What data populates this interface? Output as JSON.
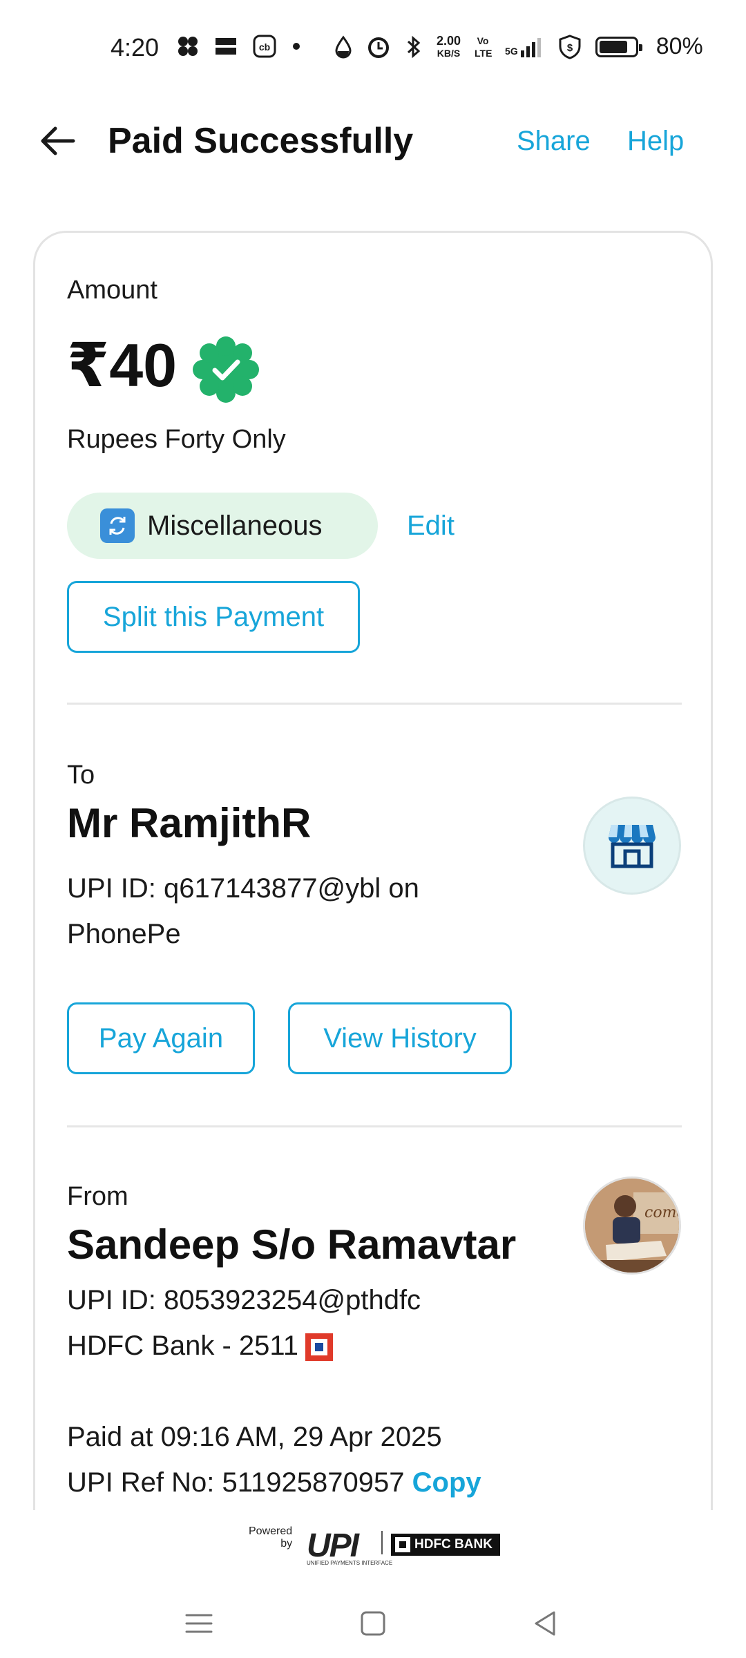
{
  "status_bar": {
    "time": "4:20",
    "net_speed": "2.00",
    "net_unit": "KB/S",
    "volte": "Vo LTE",
    "signal": "5G",
    "battery_pct": "80%",
    "battery_level": 0.8,
    "icons": [
      "pinwheel-icon",
      "news-app-icon",
      "cb-app-icon",
      "dot-icon",
      "drop-icon",
      "alarm-icon",
      "bluetooth-icon",
      "shield-dollar-icon",
      "battery-icon"
    ]
  },
  "header": {
    "title": "Paid Successfully",
    "share_label": "Share",
    "help_label": "Help"
  },
  "amount_section": {
    "label": "Amount",
    "amount": "₹40",
    "words": "Rupees Forty Only",
    "category": "Miscellaneous",
    "edit_label": "Edit",
    "split_label": "Split this Payment"
  },
  "to_section": {
    "label": "To",
    "name": "Mr RamjithR",
    "upi_line1": "UPI ID: q617143877@ybl on",
    "upi_line2": "PhonePe",
    "pay_again_label": "Pay Again",
    "view_history_label": "View History"
  },
  "from_section": {
    "label": "From",
    "name": "Sandeep S/o Ramavtar",
    "upi_id": "UPI ID: 8053923254@pthdfc",
    "bank": "HDFC Bank - 2511",
    "paid_at": "Paid at 09:16 AM, 29 Apr 2025",
    "ref_no": "UPI Ref No: 511925870957",
    "copy_label": "Copy"
  },
  "footer": {
    "powered_line1": "Powered",
    "powered_line2": "by",
    "upi_text": "UPI",
    "upi_sub": "UNIFIED PAYMENTS INTERFACE",
    "bank_text": "HDFC BANK"
  },
  "colors": {
    "accent": "#17a5d9",
    "success": "#23b26b",
    "chip_bg": "#e2f5e8"
  }
}
